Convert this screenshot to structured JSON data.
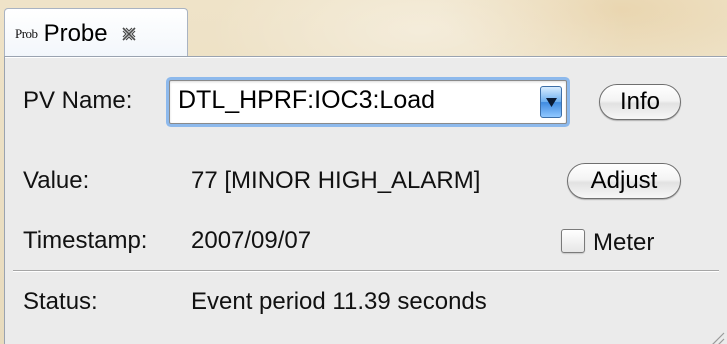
{
  "tab": {
    "icon_text": "Prob",
    "title": "Probe"
  },
  "form": {
    "pv_name_label": "PV Name:",
    "pv_name_value": "DTL_HPRF:IOC3:Load",
    "info_label": "Info",
    "value_label": "Value:",
    "value_text": "77 [MINOR HIGH_ALARM]",
    "adjust_label": "Adjust",
    "timestamp_label": "Timestamp:",
    "timestamp_value": "2007/09/07",
    "meter_label": "Meter",
    "meter_checked": false,
    "status_label": "Status:",
    "status_value": "Event period 11.39 seconds"
  },
  "colors": {
    "focus_ring": "#8db9ec",
    "combo_arrow_blue": "#3f8be0",
    "panel_bg": "#ebebeb",
    "desktop_bg": "#e8dbbd"
  },
  "icons": {
    "tab": "probe-app-icon",
    "close": "close-x-icon",
    "dropdown": "chevron-down-icon",
    "resize": "resize-grip-icon"
  }
}
